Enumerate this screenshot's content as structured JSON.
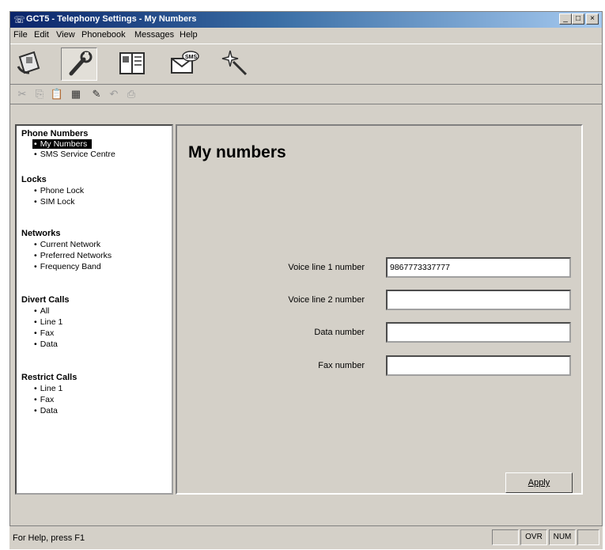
{
  "window": {
    "title": "GCT5 - Telephony Settings - My Numbers",
    "controls": [
      "_",
      "□",
      "×"
    ]
  },
  "menu": [
    "File",
    "Edit",
    "View",
    "Phonebook",
    "Messages",
    "Help"
  ],
  "big_toolbar": [
    "phone-icon",
    "wrench-icon",
    "phonebook-icon",
    "sms-envelope-icon",
    "magic-wand-icon"
  ],
  "small_toolbar": [
    "✂",
    "⎘",
    "📋",
    "▦",
    "✎",
    "↶",
    "⎙"
  ],
  "nav": {
    "groups": [
      {
        "title": "Phone Numbers",
        "items": [
          "My Numbers",
          "SMS Service Centre"
        ],
        "selected": "My Numbers"
      },
      {
        "title": "Locks",
        "items": [
          "Phone Lock",
          "SIM Lock"
        ]
      },
      {
        "title": "Networks",
        "items": [
          "Current Network",
          "Preferred Networks",
          "Frequency Band"
        ]
      },
      {
        "title": "Divert Calls",
        "items": [
          "All",
          "Line 1",
          "Fax",
          "Data"
        ]
      },
      {
        "title": "Restrict Calls",
        "items": [
          "Line 1",
          "Fax",
          "Data"
        ]
      }
    ]
  },
  "main": {
    "heading": "My numbers",
    "fields": [
      {
        "label": "Voice line 1 number",
        "value": "9867773337777"
      },
      {
        "label": "Voice line 2 number",
        "value": ""
      },
      {
        "label": "Data number",
        "value": ""
      },
      {
        "label": "Fax number",
        "value": ""
      }
    ],
    "apply_label": "Apply"
  },
  "status": {
    "help": "For Help, press F1",
    "panels": [
      "",
      "OVR",
      "NUM",
      ""
    ]
  }
}
